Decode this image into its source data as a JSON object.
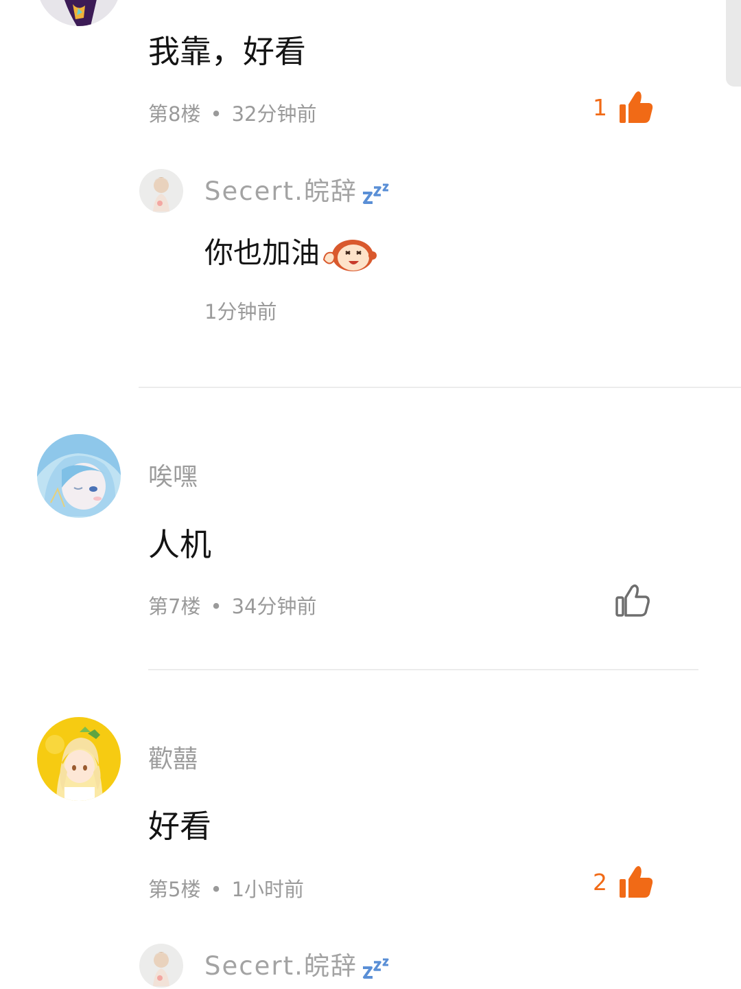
{
  "comments": [
    {
      "username": "",
      "text": "我靠，好看",
      "floor": "第8楼",
      "time": "32分钟前",
      "likes": "1",
      "liked": true,
      "reply": {
        "username": "Secert.皖辞",
        "text": "你也加油",
        "time": "1分钟前",
        "badge_icon": "zzz-sleep-icon",
        "emoji_icon": "monkey-emoji-icon"
      }
    },
    {
      "username": "唉嘿",
      "text": "人机",
      "floor": "第7楼",
      "time": "34分钟前",
      "likes": "",
      "liked": false
    },
    {
      "username": "歡囍",
      "text": "好看",
      "floor": "第5楼",
      "time": "1小时前",
      "likes": "2",
      "liked": true,
      "reply": {
        "username": "Secert.皖辞",
        "badge_icon": "zzz-sleep-icon"
      }
    }
  ],
  "meta_separator": "•",
  "colors": {
    "accent": "#f16a16",
    "meta_text": "#9a9a9a",
    "body_text": "#141414",
    "divider": "#ececec",
    "like_inactive": "#6e6e6e"
  }
}
